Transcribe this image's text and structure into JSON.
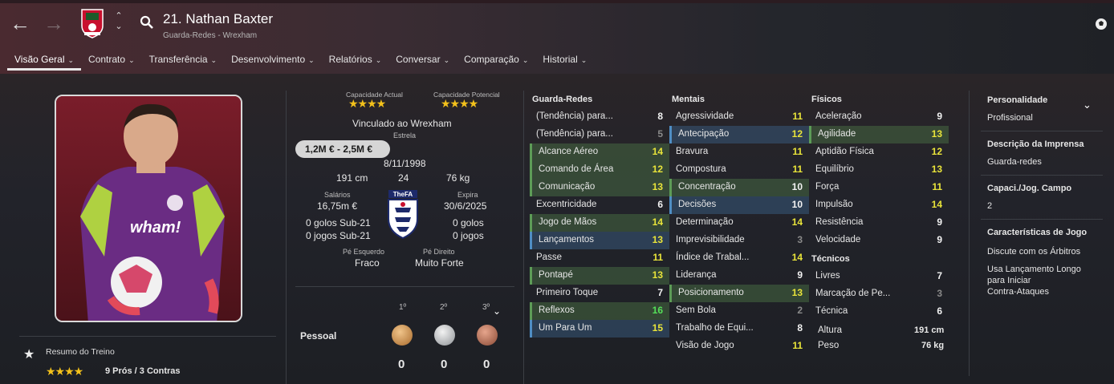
{
  "header": {
    "title": "21. Nathan Baxter",
    "subtitle": "Guarda-Redes - Wrexham",
    "back": "←",
    "forward": "→",
    "up": "⌃",
    "down": "⌄"
  },
  "tabs": [
    {
      "label": "Visão Geral"
    },
    {
      "label": "Contrato"
    },
    {
      "label": "Transferência"
    },
    {
      "label": "Desenvolvimento"
    },
    {
      "label": "Relatórios"
    },
    {
      "label": "Conversar"
    },
    {
      "label": "Comparação"
    },
    {
      "label": "Historial"
    }
  ],
  "profile": {
    "current_ability_label": "Capacidade Actual",
    "current_ability_stars": 4,
    "potential_ability_label": "Capacidade Potencial",
    "potential_ability_stars": 4,
    "club_status": "Vinculado ao Wrexham",
    "role_status": "Estrela",
    "value": "1,2M € - 2,5M €",
    "dob": "8/11/1998",
    "height": "191 cm",
    "age": "24",
    "weight": "76 kg",
    "wages_label": "Salários",
    "wages": "16,75m €",
    "expires_label": "Expira",
    "expires": "30/6/2025",
    "u21_goals_left": "0 golos Sub-21",
    "u21_caps_left": "0 jogos Sub-21",
    "u21_goals_right": "0 golos",
    "u21_caps_right": "0 jogos",
    "left_foot_label": "Pé Esquerdo",
    "left_foot": "Fraco",
    "right_foot_label": "Pé Direito",
    "right_foot": "Muito Forte",
    "fa_badge": "TheFA"
  },
  "awards": {
    "row_label": "Pessoal",
    "cols": [
      "1º",
      "2º",
      "3º"
    ],
    "values": [
      "0",
      "0",
      "0"
    ]
  },
  "training": {
    "label": "Resumo do Treino",
    "stars": 4,
    "summary": "9 Prós / 3 Contras"
  },
  "gk": {
    "title": "Guarda-Redes",
    "rows": [
      {
        "label": "(Tendência) para...",
        "value": "8",
        "hl": "",
        "c": "n-w"
      },
      {
        "label": "(Tendência) para...",
        "value": "5",
        "hl": "",
        "c": "n-grey"
      },
      {
        "label": "Alcance Aéreo",
        "value": "14",
        "hl": "g",
        "c": "n-y"
      },
      {
        "label": "Comando de Área",
        "value": "12",
        "hl": "g",
        "c": "n-y"
      },
      {
        "label": "Comunicação",
        "value": "13",
        "hl": "g",
        "c": "n-y"
      },
      {
        "label": "Excentricidade",
        "value": "6",
        "hl": "",
        "c": "n-w"
      },
      {
        "label": "Jogo de Mãos",
        "value": "14",
        "hl": "g",
        "c": "n-y"
      },
      {
        "label": "Lançamentos",
        "value": "13",
        "hl": "b",
        "c": "n-y"
      },
      {
        "label": "Passe",
        "value": "11",
        "hl": "",
        "c": "n-y"
      },
      {
        "label": "Pontapé",
        "value": "13",
        "hl": "g",
        "c": "n-y"
      },
      {
        "label": "Primeiro Toque",
        "value": "7",
        "hl": "",
        "c": "n-w"
      },
      {
        "label": "Reflexos",
        "value": "16",
        "hl": "g",
        "c": "n-g"
      },
      {
        "label": "Um Para Um",
        "value": "15",
        "hl": "b",
        "c": "n-y"
      }
    ]
  },
  "mental": {
    "title": "Mentais",
    "rows": [
      {
        "label": "Agressividade",
        "value": "11",
        "hl": "",
        "c": "n-y"
      },
      {
        "label": "Antecipação",
        "value": "12",
        "hl": "b",
        "c": "n-y"
      },
      {
        "label": "Bravura",
        "value": "11",
        "hl": "",
        "c": "n-y"
      },
      {
        "label": "Compostura",
        "value": "11",
        "hl": "",
        "c": "n-y"
      },
      {
        "label": "Concentração",
        "value": "10",
        "hl": "g",
        "c": "n-w"
      },
      {
        "label": "Decisões",
        "value": "10",
        "hl": "b",
        "c": "n-w"
      },
      {
        "label": "Determinação",
        "value": "14",
        "hl": "",
        "c": "n-y"
      },
      {
        "label": "Imprevisibilidade",
        "value": "3",
        "hl": "",
        "c": "n-grey"
      },
      {
        "label": "Índice de Trabal...",
        "value": "14",
        "hl": "",
        "c": "n-y"
      },
      {
        "label": "Liderança",
        "value": "9",
        "hl": "",
        "c": "n-w"
      },
      {
        "label": "Posicionamento",
        "value": "13",
        "hl": "g",
        "c": "n-y"
      },
      {
        "label": "Sem Bola",
        "value": "2",
        "hl": "",
        "c": "n-grey"
      },
      {
        "label": "Trabalho de Equi...",
        "value": "8",
        "hl": "",
        "c": "n-w"
      },
      {
        "label": "Visão de Jogo",
        "value": "11",
        "hl": "",
        "c": "n-y"
      }
    ]
  },
  "physical": {
    "title": "Físicos",
    "rows": [
      {
        "label": "Aceleração",
        "value": "9",
        "hl": "",
        "c": "n-w"
      },
      {
        "label": "Agilidade",
        "value": "13",
        "hl": "g",
        "c": "n-y"
      },
      {
        "label": "Aptidão Física",
        "value": "12",
        "hl": "",
        "c": "n-y"
      },
      {
        "label": "Equilíbrio",
        "value": "13",
        "hl": "",
        "c": "n-y"
      },
      {
        "label": "Força",
        "value": "11",
        "hl": "",
        "c": "n-y"
      },
      {
        "label": "Impulsão",
        "value": "14",
        "hl": "",
        "c": "n-y"
      },
      {
        "label": "Resistência",
        "value": "9",
        "hl": "",
        "c": "n-w"
      },
      {
        "label": "Velocidade",
        "value": "9",
        "hl": "",
        "c": "n-w"
      }
    ]
  },
  "technical": {
    "title": "Técnicos",
    "rows": [
      {
        "label": "Livres",
        "value": "7",
        "hl": "",
        "c": "n-w"
      },
      {
        "label": "Marcação de Pe...",
        "value": "3",
        "hl": "",
        "c": "n-grey"
      },
      {
        "label": "Técnica",
        "value": "6",
        "hl": "",
        "c": "n-w"
      }
    ]
  },
  "measures": {
    "height_label": "Altura",
    "height": "191 cm",
    "weight_label": "Peso",
    "weight": "76 kg"
  },
  "side": {
    "personality_label": "Personalidade",
    "personality": "Profissional",
    "press_label": "Descrição da Imprensa",
    "press": "Guarda-redes",
    "pitch_label": "Capaci./Jog. Campo",
    "pitch": "2",
    "traits_label": "Características de Jogo",
    "traits": [
      "Discute com os Árbitros",
      "Usa Lançamento Longo",
      "para Iniciar",
      "Contra-Ataques"
    ]
  },
  "colors": {
    "accent_yellow": "#e9e43a",
    "accent_green": "#55e059",
    "highlight_green": "#5d9c57",
    "highlight_blue": "#4f8ec4",
    "star": "#f3c11b"
  }
}
